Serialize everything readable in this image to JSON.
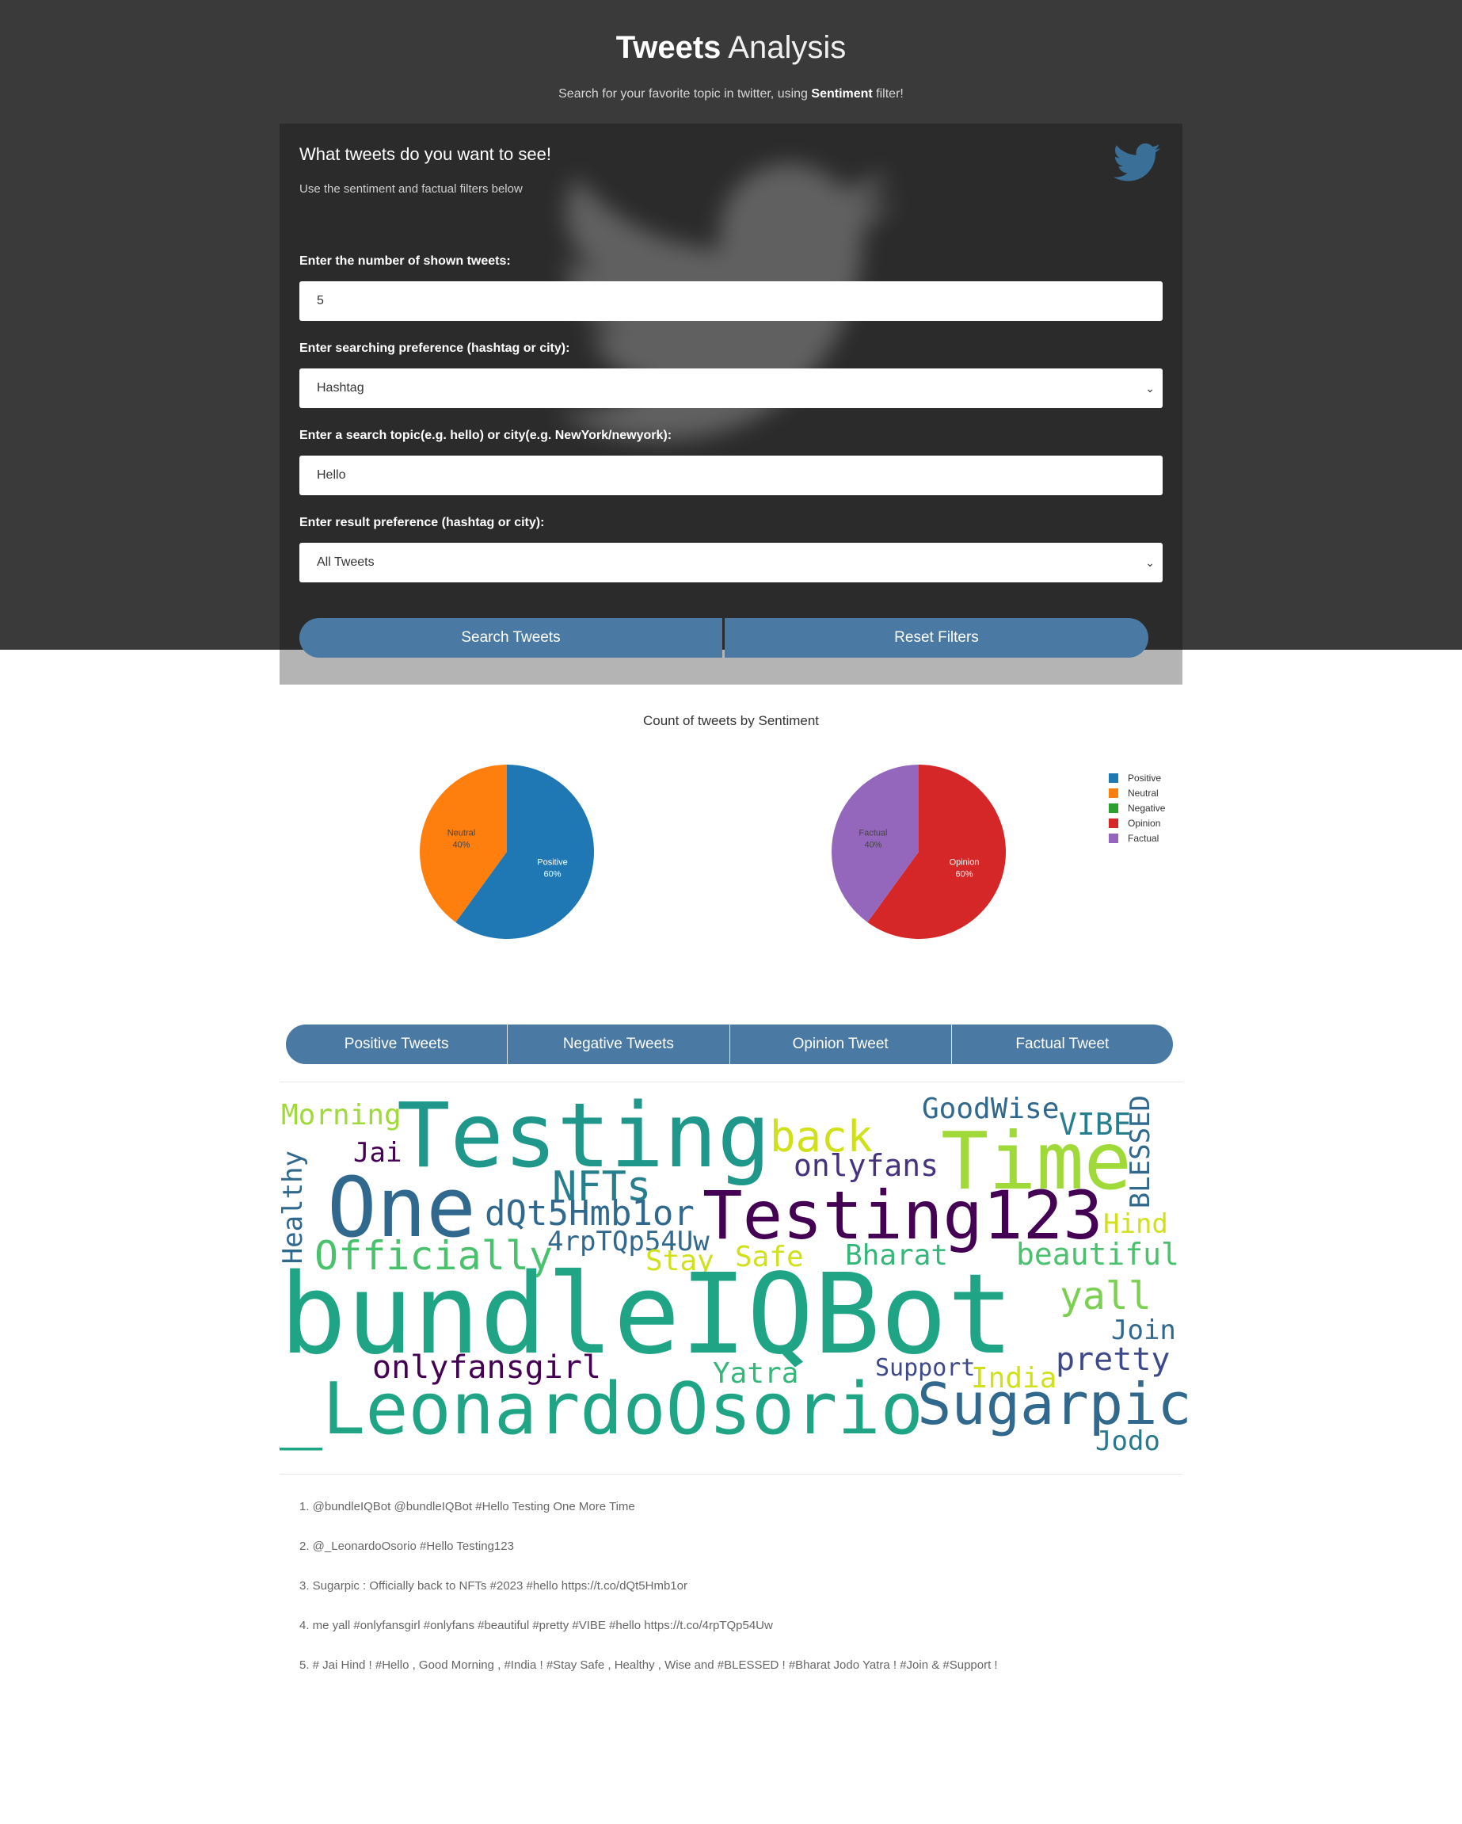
{
  "header": {
    "title_bold": "Tweets",
    "title_light": "Analysis",
    "subtitle_pre": "Search for your favorite topic in twitter, using ",
    "subtitle_bold": "Sentiment",
    "subtitle_post": " filter!"
  },
  "form": {
    "title": "What tweets do you want to see!",
    "subtitle": "Use the sentiment and factual filters below",
    "count_label": "Enter the number of shown tweets:",
    "count_value": "5",
    "pref_label": "Enter searching preference (hashtag or city):",
    "pref_value": "Hashtag",
    "topic_label": "Enter a search topic(e.g. hello) or city(e.g. NewYork/newyork):",
    "topic_value": "Hello",
    "result_label": "Enter result preference (hashtag or city):",
    "result_value": "All Tweets",
    "search_button": "Search Tweets",
    "reset_button": "Reset Filters"
  },
  "chart_data": [
    {
      "type": "pie",
      "title": "Count of tweets by Sentiment",
      "labels": [
        "Positive",
        "Neutral"
      ],
      "values": [
        60,
        40
      ],
      "value_labels": [
        "60%",
        "40%"
      ],
      "colors": [
        "#1f77b4",
        "#ff7f0e"
      ]
    },
    {
      "type": "pie",
      "labels": [
        "Opinion",
        "Factual"
      ],
      "values": [
        60,
        40
      ],
      "value_labels": [
        "60%",
        "40%"
      ],
      "colors": [
        "#d62728",
        "#9467bd"
      ]
    }
  ],
  "legend": [
    {
      "name": "Positive",
      "color": "#1f77b4"
    },
    {
      "name": "Neutral",
      "color": "#ff7f0e"
    },
    {
      "name": "Negative",
      "color": "#2ca02c"
    },
    {
      "name": "Opinion",
      "color": "#d62728"
    },
    {
      "name": "Factual",
      "color": "#9467bd"
    }
  ],
  "tabs": [
    "Positive Tweets",
    "Negative Tweets",
    "Opinion Tweet",
    "Factual Tweet"
  ],
  "wordcloud": {
    "morning": "Morning",
    "testing": "Testing",
    "back": "back",
    "goodwise": "GoodWise",
    "time": "Time",
    "vibe": "VIBE",
    "blessed": "BLESSED",
    "jai": "Jai",
    "onlyfans": "onlyfans",
    "healthy": "Healthy",
    "one": "One",
    "nfts": "NFTs",
    "dqt": "dQt5Hmb1or",
    "testing123": "Testing123",
    "hind": "Hind",
    "rpt": "4rpTQp54Uw",
    "officially": "Officially",
    "stay": "Stay",
    "safe": "Safe",
    "bharat": "Bharat",
    "beautiful": "beautiful",
    "bundle": "bundleIQBot",
    "yall": "yall",
    "join": "Join",
    "pretty": "pretty",
    "onlyfansgirl": "onlyfansgirl",
    "support": "Support",
    "yatra": "Yatra",
    "india": "India",
    "leonardo": "_LeonardoOsorio",
    "sugarpic": "Sugarpic",
    "jodo": "Jodo"
  },
  "tweets": [
    "1. @bundleIQBot @bundleIQBot #Hello Testing One More Time",
    "2. @_LeonardoOsorio #Hello Testing123",
    "3. Sugarpic : Officially back to NFTs #2023 #hello https://t.co/dQt5Hmb1or",
    "4. me yall #onlyfansgirl #onlyfans #beautiful #pretty #VIBE #hello https://t.co/4rpTQp54Uw",
    "5. # Jai Hind ! #Hello , Good Morning , #India ! #Stay Safe , Healthy , Wise and #BLESSED ! #Bharat Jodo Yatra ! #Join & #Support !"
  ]
}
